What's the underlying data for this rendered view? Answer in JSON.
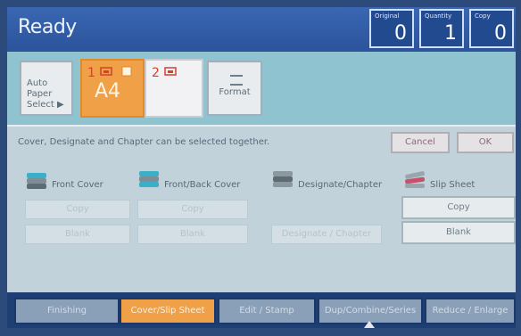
{
  "header": {
    "status": "Ready",
    "counters": [
      {
        "label": "Original",
        "value": "0"
      },
      {
        "label": "Quantity",
        "value": "1"
      },
      {
        "label": "Copy",
        "value": "0"
      }
    ]
  },
  "paper": {
    "auto_select": "Auto Paper Select ▶",
    "trays": [
      {
        "number": "1",
        "size": "A4"
      },
      {
        "number": "2",
        "size": ""
      }
    ],
    "format_label": "Format"
  },
  "main": {
    "instruction": "Cover, Designate and Chapter can be selected together.",
    "cancel": "Cancel",
    "ok": "OK",
    "groups": [
      {
        "name": "Front Cover",
        "buttons": [
          "Copy",
          "Blank"
        ]
      },
      {
        "name": "Front/Back Cover",
        "buttons": [
          "Copy",
          "Blank"
        ]
      },
      {
        "name": "Designate/Chapter",
        "buttons": [
          "Designate / Chapter"
        ]
      },
      {
        "name": "Slip Sheet",
        "buttons": [
          "Copy",
          "Blank"
        ]
      }
    ]
  },
  "tabs": [
    {
      "label": "Finishing",
      "active": false
    },
    {
      "label": "Cover/Slip Sheet",
      "active": true
    },
    {
      "label": "Edit / Stamp",
      "active": false
    },
    {
      "label": "Dup/Combine/Series",
      "active": false
    },
    {
      "label": "Reduce / Enlarge",
      "active": false
    }
  ]
}
